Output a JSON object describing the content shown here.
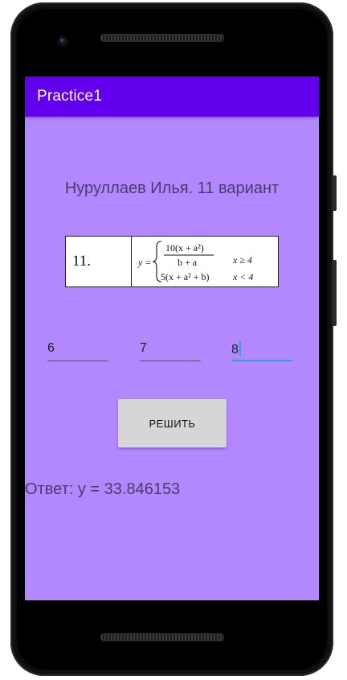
{
  "app_bar": {
    "title": "Practice1",
    "color": "#6200ee"
  },
  "screen": {
    "background": "#b388ff"
  },
  "heading": "Нуруллаев Илья. 11 вариант",
  "formula": {
    "number": "11.",
    "lhs": "y =",
    "case1_numerator": "10(x + a²)",
    "case1_denominator": "b + a",
    "case1_condition": "x ≥ 4",
    "case2_expression": "5(x + a² + b)",
    "case2_condition": "x < 4"
  },
  "inputs": [
    {
      "value": "6"
    },
    {
      "value": "7"
    },
    {
      "value": "8",
      "focused": true
    }
  ],
  "solve_button": {
    "label": "РЕШИТЬ"
  },
  "answer": "Ответ: y = 33.846153"
}
